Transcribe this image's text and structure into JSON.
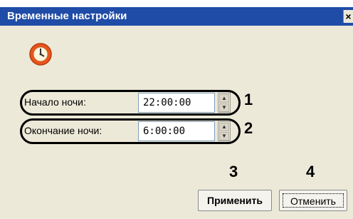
{
  "window": {
    "title": "Временные настройки",
    "close_label": "×"
  },
  "icon": {
    "name": "clock-icon"
  },
  "fields": [
    {
      "label": "Начало ночи:",
      "value": "22:00:00",
      "marker": "1"
    },
    {
      "label": "Окончание ночи:",
      "value": "6:00:00",
      "marker": "2"
    }
  ],
  "buttons": {
    "apply_label": "Применить",
    "apply_marker": "3",
    "cancel_label": "Отменить",
    "cancel_marker": "4"
  },
  "colors": {
    "titlebar": "#1f4ca6",
    "background": "#ece9d8"
  }
}
